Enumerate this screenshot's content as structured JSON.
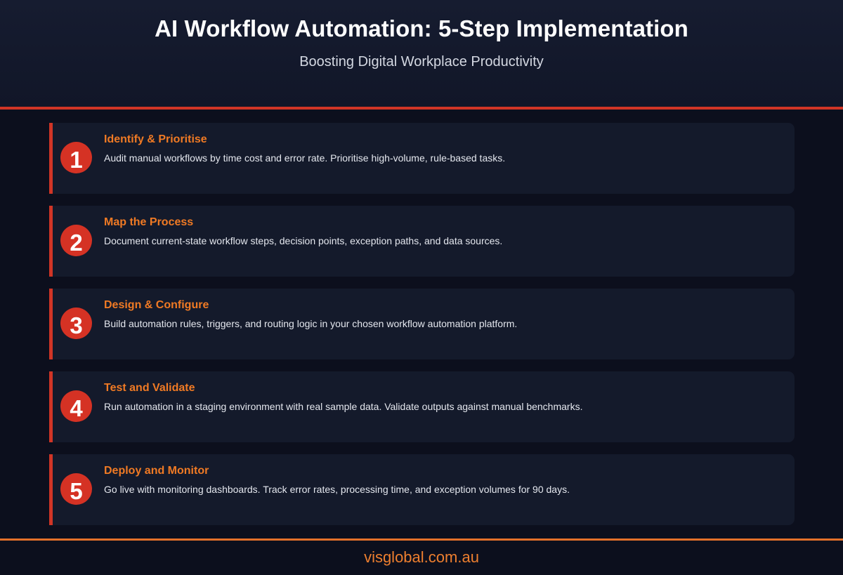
{
  "header": {
    "title": "AI Workflow Automation: 5-Step Implementation",
    "subtitle": "Boosting Digital Workplace Productivity"
  },
  "colors": {
    "accent_red": "#d03526",
    "accent_orange": "#f07a24",
    "background": "#0c0f1d",
    "card": "#141a2b"
  },
  "steps": [
    {
      "number": "1",
      "title": "Identify & Prioritise",
      "description": "Audit manual workflows by time cost and error rate. Prioritise high-volume, rule-based tasks."
    },
    {
      "number": "2",
      "title": "Map the Process",
      "description": "Document current-state workflow steps, decision points, exception paths, and data sources."
    },
    {
      "number": "3",
      "title": "Design & Configure",
      "description": "Build automation rules, triggers, and routing logic in your chosen workflow automation platform."
    },
    {
      "number": "4",
      "title": "Test and Validate",
      "description": "Run automation in a staging environment with real sample data. Validate outputs against manual benchmarks."
    },
    {
      "number": "5",
      "title": "Deploy and Monitor",
      "description": "Go live with monitoring dashboards. Track error rates, processing time, and exception volumes for 90 days."
    }
  ],
  "footer": {
    "website": "visglobal.com.au"
  }
}
